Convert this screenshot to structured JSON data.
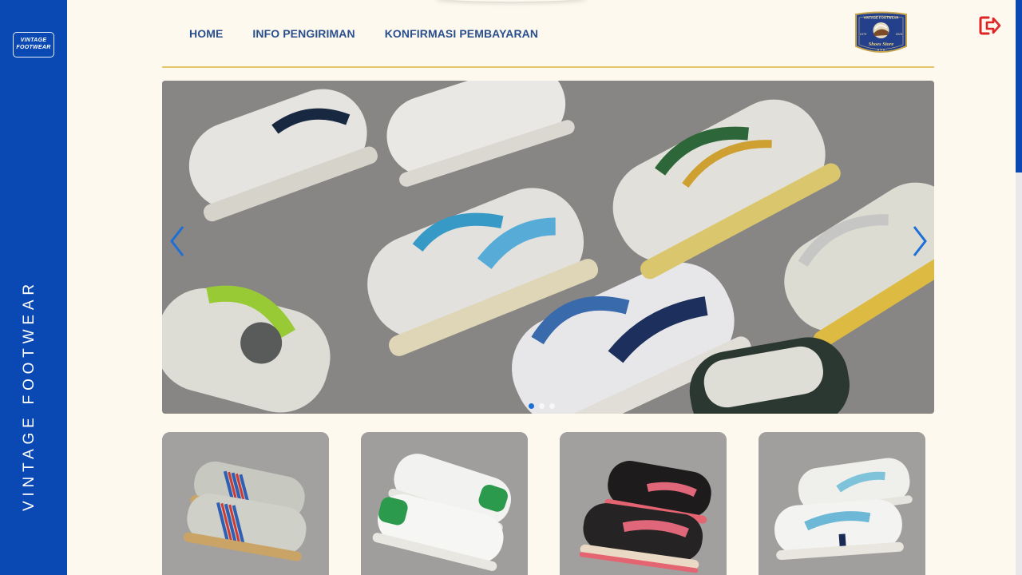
{
  "brand": {
    "sidebar_logo_line1": "VINTAGE",
    "sidebar_logo_line2": "FOOTWEAR",
    "sidebar_vertical_text": "VINTAGE FOOTWEAR",
    "badge_top": "VINTAGE FOOTWEAR",
    "badge_left": "1979",
    "badge_right": "2023",
    "badge_script": "Shoes Store"
  },
  "nav": {
    "items": [
      {
        "label": "HOME"
      },
      {
        "label": "INFO PENGIRIMAN"
      },
      {
        "label": "KONFIRMASI PEMBAYARAN"
      }
    ]
  },
  "icons": {
    "logout": "logout-icon",
    "prev": "chevron-left-icon",
    "next": "chevron-right-icon"
  },
  "carousel": {
    "slide_count": 3,
    "active_index": 0
  },
  "products": [
    {
      "name": "sneaker-grey-blue-red-stripes"
    },
    {
      "name": "sneaker-white-green"
    },
    {
      "name": "sneaker-black-pink"
    },
    {
      "name": "sneaker-white-light-blue"
    }
  ],
  "colors": {
    "sidebar": "#0a49b3",
    "nav_text": "#2a4f8f",
    "rule": "#e7c56a",
    "logout": "#e02424",
    "background": "#fdf9ef"
  }
}
